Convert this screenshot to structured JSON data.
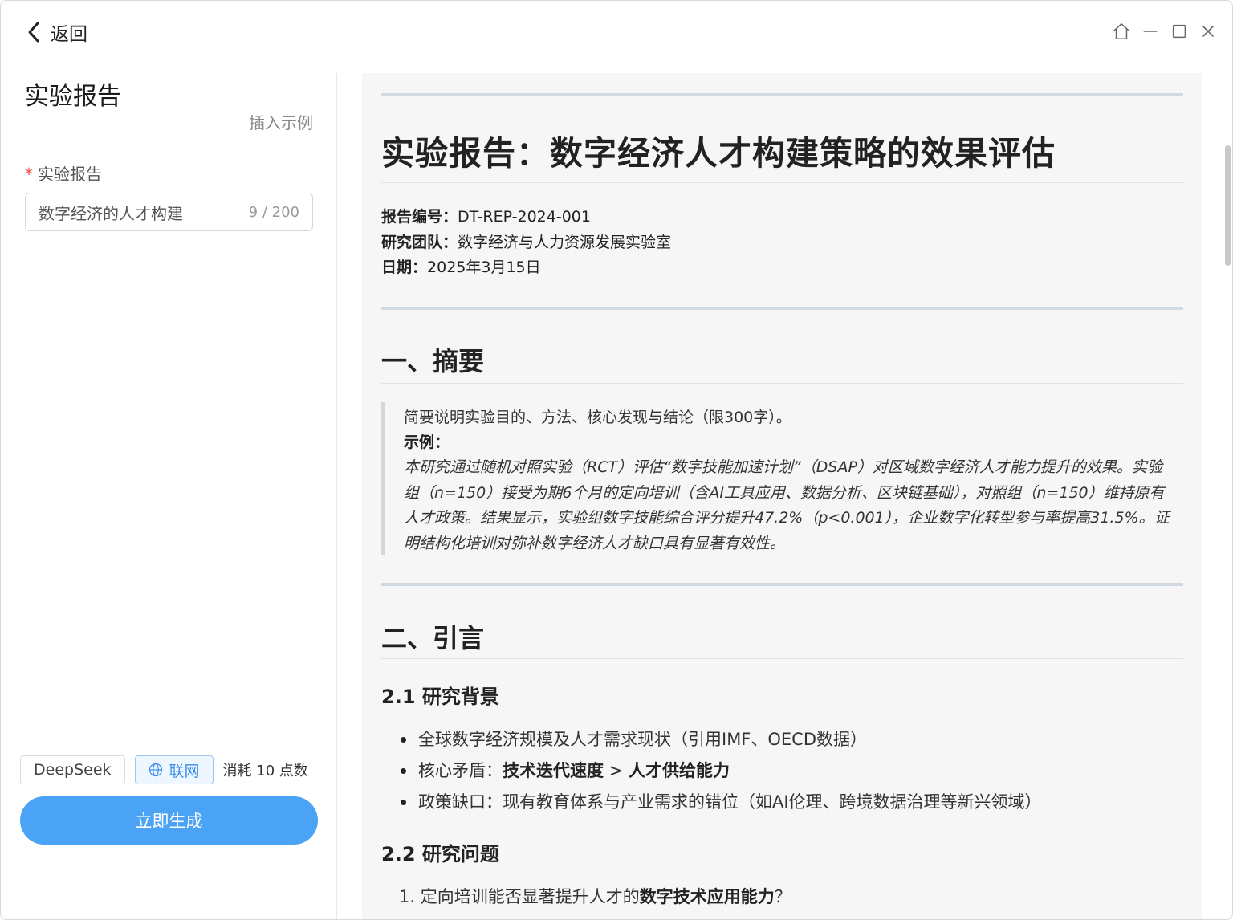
{
  "header": {
    "back_label": "返回"
  },
  "left": {
    "title": "实验报告",
    "insert_example": "插入示例",
    "field_label": "实验报告",
    "field_required_mark": "*",
    "input_value": "数字经济的人才构建",
    "input_count": "9 / 200",
    "model_chip": "DeepSeek",
    "web_chip": "联网",
    "cost_text": "消耗 10 点数",
    "generate_label": "立即生成"
  },
  "doc": {
    "title": "实验报告：数字经济人才构建策略的效果评估",
    "meta": [
      {
        "key": "报告编号",
        "value": "DT-REP-2024-001"
      },
      {
        "key": "研究团队",
        "value": "数字经济与人力资源发展实验室"
      },
      {
        "key": "日期",
        "value": "2025年3月15日"
      }
    ],
    "meta_separator": "：",
    "sec1_title": "一、摘要",
    "sec1_quote_line": "简要说明实验目的、方法、核心发现与结论（限300字）。",
    "sec1_example_label": "示例：",
    "sec1_example_text": "本研究通过随机对照实验（RCT）评估“数字技能加速计划”（DSAP）对区域数字经济人才能力提升的效果。实验组（n=150）接受为期6个月的定向培训（含AI工具应用、数据分析、区块链基础），对照组（n=150）维持原有人才政策。结果显示，实验组数字技能综合评分提升47.2%（p<0.001），企业数字化转型参与率提高31.5%。证明结构化培训对弥补数字经济人才缺口具有显著有效性。",
    "sec2_title": "二、引言",
    "sec21_title": "2.1 研究背景",
    "bullet1": "全球数字经济规模及人才需求现状（引用IMF、OECD数据）",
    "bullet2_prefix": "核心矛盾：",
    "bullet2_bold1": "技术迭代速度",
    "bullet2_mid": " > ",
    "bullet2_bold2": "人才供给能力",
    "bullet3": "政策缺口：现有教育体系与产业需求的错位（如AI伦理、跨境数据治理等新兴领域）",
    "sec22_title": "2.2 研究问题",
    "ol1_prefix": "1. 定向培训能否显著提升人才的",
    "ol1_bold": "数字技术应用能力",
    "ol1_suffix": "？"
  }
}
